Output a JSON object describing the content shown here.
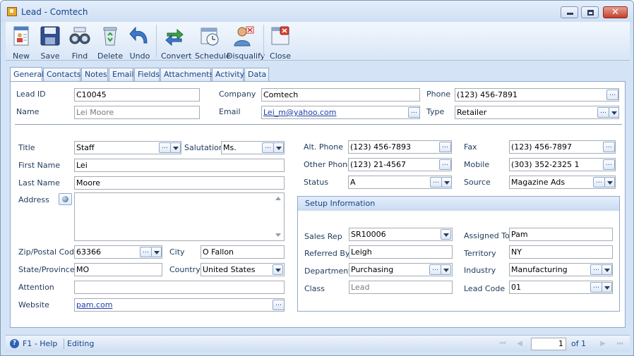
{
  "window": {
    "title": "Lead - Comtech"
  },
  "toolbar": {
    "new": "New",
    "save": "Save",
    "find": "Find",
    "delete": "Delete",
    "undo": "Undo",
    "convert": "Convert",
    "schedule": "Schedule",
    "disqualify": "Disqualify",
    "close": "Close"
  },
  "tabs": [
    "General",
    "Contacts",
    "Notes",
    "Email",
    "Fields",
    "Attachments",
    "Activity",
    "Data"
  ],
  "header": {
    "lead_id_label": "Lead ID",
    "lead_id": "C10045",
    "name_label": "Name",
    "name_placeholder": "Lei Moore",
    "company_label": "Company",
    "company": "Comtech",
    "email_label": "Email",
    "email": "Lei_m@yahoo.com",
    "phone_label": "Phone",
    "phone": "(123) 456-7891",
    "type_label": "Type",
    "type": "Retailer"
  },
  "contact": {
    "title_label": "Title",
    "title": "Staff",
    "salutation_label": "Salutation",
    "salutation": "Ms.",
    "first_name_label": "First Name",
    "first_name": "Lei",
    "last_name_label": "Last Name",
    "last_name": "Moore",
    "address_label": "Address",
    "address": "",
    "zip_label": "Zip/Postal Code",
    "zip": "63366",
    "city_label": "City",
    "city": "O Fallon",
    "state_label": "State/Province",
    "state": "MO",
    "country_label": "Country",
    "country": "United States",
    "attention_label": "Attention",
    "attention": "",
    "website_label": "Website",
    "website": "pam.com"
  },
  "phones": {
    "alt_phone_label": "Alt. Phone",
    "alt_phone": "(123) 456-7893",
    "fax_label": "Fax",
    "fax": "(123) 456-7897",
    "other_phone_label": "Other Phone",
    "other_phone": "(123) 21-4567",
    "mobile_label": "Mobile",
    "mobile": "(303) 352-2325 1",
    "status_label": "Status",
    "status": "A",
    "source_label": "Source",
    "source": "Magazine Ads"
  },
  "setup": {
    "header": "Setup Information",
    "sales_rep_label": "Sales Rep",
    "sales_rep": "SR10006",
    "assigned_to_label": "Assigned To",
    "assigned_to": "Pam",
    "referred_by_label": "Referred By",
    "referred_by": "Leigh",
    "territory_label": "Territory",
    "territory": "NY",
    "department_label": "Department",
    "department": "Purchasing",
    "industry_label": "Industry",
    "industry": "Manufacturing",
    "class_label": "Class",
    "class_placeholder": "Lead",
    "lead_code_label": "Lead Code",
    "lead_code": "01"
  },
  "status": {
    "help": "F1 - Help",
    "mode": "Editing",
    "page": "1",
    "of_label": "of",
    "total_pages": "1"
  },
  "colors": {
    "accent": "#15428b",
    "chrome": "#d4e3f6",
    "border": "#8ea9cd"
  },
  "icons": {
    "ellipsis": "…"
  }
}
